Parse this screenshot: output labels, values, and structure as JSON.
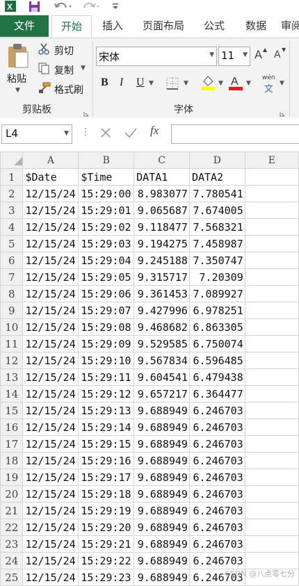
{
  "ribbon": {
    "tabs": [
      "文件",
      "开始",
      "插入",
      "页面布局",
      "公式",
      "数据",
      "审阅"
    ],
    "clipboard": {
      "paste": "粘贴",
      "cut": "剪切",
      "copy": "复制",
      "format_painter": "格式刷",
      "group": "剪贴板"
    },
    "font": {
      "name": "宋体",
      "size": "11",
      "bold": "B",
      "italic": "I",
      "underline": "U",
      "group": "字体",
      "grow": "A",
      "shrink": "A",
      "phonetic": "wén"
    }
  },
  "formula_bar": {
    "name_box": "L4",
    "fx": "fx",
    "value": ""
  },
  "sheet": {
    "columns": [
      "A",
      "B",
      "C",
      "D",
      "E"
    ],
    "rows": [
      {
        "n": "1",
        "a": "$Date",
        "b": "$Time",
        "c": "DATA1",
        "d": "DATA2"
      },
      {
        "n": "2",
        "a": "12/15/24",
        "b": "15:29:00",
        "c": "8.983077",
        "d": "7.780541"
      },
      {
        "n": "3",
        "a": "12/15/24",
        "b": "15:29:01",
        "c": "9.065687",
        "d": "7.674005"
      },
      {
        "n": "4",
        "a": "12/15/24",
        "b": "15:29:02",
        "c": "9.118477",
        "d": "7.568321"
      },
      {
        "n": "5",
        "a": "12/15/24",
        "b": "15:29:03",
        "c": "9.194275",
        "d": "7.458987"
      },
      {
        "n": "6",
        "a": "12/15/24",
        "b": "15:29:04",
        "c": "9.245188",
        "d": "7.350747"
      },
      {
        "n": "7",
        "a": "12/15/24",
        "b": "15:29:05",
        "c": "9.315717",
        "d": "7.20309"
      },
      {
        "n": "8",
        "a": "12/15/24",
        "b": "15:29:06",
        "c": "9.361453",
        "d": "7.089927"
      },
      {
        "n": "9",
        "a": "12/15/24",
        "b": "15:29:07",
        "c": "9.427996",
        "d": "6.978251"
      },
      {
        "n": "10",
        "a": "12/15/24",
        "b": "15:29:08",
        "c": "9.468682",
        "d": "6.863305"
      },
      {
        "n": "11",
        "a": "12/15/24",
        "b": "15:29:09",
        "c": "9.529585",
        "d": "6.750074"
      },
      {
        "n": "12",
        "a": "12/15/24",
        "b": "15:29:10",
        "c": "9.567834",
        "d": "6.596485"
      },
      {
        "n": "13",
        "a": "12/15/24",
        "b": "15:29:11",
        "c": "9.604541",
        "d": "6.479438"
      },
      {
        "n": "14",
        "a": "12/15/24",
        "b": "15:29:12",
        "c": "9.657217",
        "d": "6.364477"
      },
      {
        "n": "15",
        "a": "12/15/24",
        "b": "15:29:13",
        "c": "9.688949",
        "d": "6.246703"
      },
      {
        "n": "16",
        "a": "12/15/24",
        "b": "15:29:14",
        "c": "9.688949",
        "d": "6.246703"
      },
      {
        "n": "17",
        "a": "12/15/24",
        "b": "15:29:15",
        "c": "9.688949",
        "d": "6.246703"
      },
      {
        "n": "18",
        "a": "12/15/24",
        "b": "15:29:16",
        "c": "9.688949",
        "d": "6.246703"
      },
      {
        "n": "19",
        "a": "12/15/24",
        "b": "15:29:17",
        "c": "9.688949",
        "d": "6.246703"
      },
      {
        "n": "20",
        "a": "12/15/24",
        "b": "15:29:18",
        "c": "9.688949",
        "d": "6.246703"
      },
      {
        "n": "21",
        "a": "12/15/24",
        "b": "15:29:19",
        "c": "9.688949",
        "d": "6.246703"
      },
      {
        "n": "22",
        "a": "12/15/24",
        "b": "15:29:20",
        "c": "9.688949",
        "d": "6.246703"
      },
      {
        "n": "23",
        "a": "12/15/24",
        "b": "15:29:21",
        "c": "9.688949",
        "d": "6.246703"
      },
      {
        "n": "24",
        "a": "12/15/24",
        "b": "15:29:22",
        "c": "9.688949",
        "d": "6.246703"
      },
      {
        "n": "25",
        "a": "12/15/24",
        "b": "15:29:23",
        "c": "9.688949",
        "d": "6.246703"
      }
    ]
  },
  "watermark": "CSDN @八点零七分",
  "colors": {
    "excel_green": "#217346",
    "underline_red": "#e31b1b",
    "highlight_yellow": "#ffff00"
  },
  "icons": [
    "excel-logo-icon",
    "save-icon",
    "undo-icon",
    "redo-icon",
    "customize-qat-icon",
    "paste-icon",
    "cut-icon",
    "copy-icon",
    "format-painter-icon",
    "border-icon",
    "fill-color-icon",
    "font-color-icon",
    "phonetic-icon",
    "dialog-launcher-icon",
    "cancel-icon",
    "enter-icon",
    "function-icon"
  ]
}
